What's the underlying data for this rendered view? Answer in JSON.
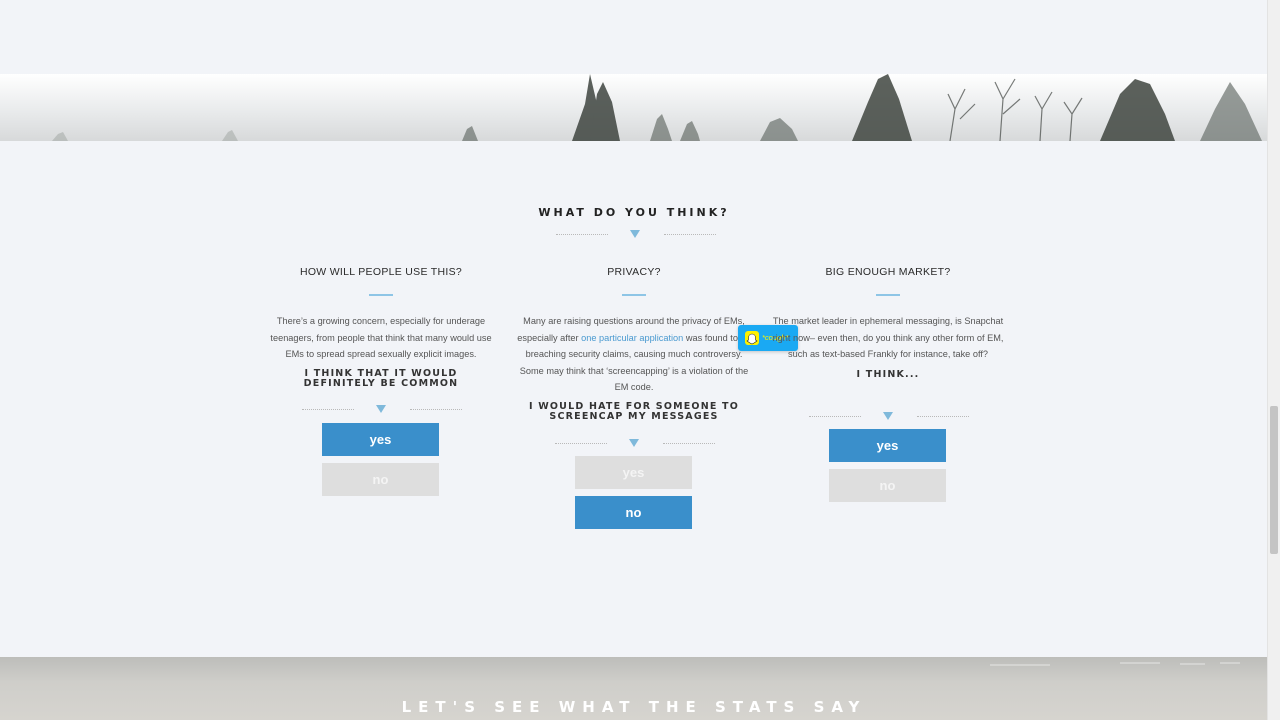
{
  "section": {
    "title": "WHAT DO YOU THINK?"
  },
  "columns": [
    {
      "heading": "HOW WILL PEOPLE USE THIS?",
      "text": "There’s a growing concern, especially for underage teenagers, from people that think that many would use EMs to spread spread sexually explicit images.",
      "opinion_line1": "I THINK THAT IT WOULD",
      "opinion_line2": "DEFINITELY BE COMMON",
      "yes_label": "yes",
      "no_label": "no",
      "selected": "yes"
    },
    {
      "heading": "PRIVACY?",
      "text_before_link": "Many are raising questions around the privacy of EMs, especially after ",
      "link_text": "one particular application",
      "text_after_link": " was found to be breaching security claims, causing much controversy. Some may think that ‘screencapping’ is a violation of the EM code.",
      "opinion_line1": "I WOULD HATE FOR SOMEONE TO",
      "opinion_line2": "SCREENCAP MY MESSAGES",
      "yes_label": "yes",
      "no_label": "no",
      "selected": "no"
    },
    {
      "heading": "BIG ENOUGH MARKET?",
      "text": "The market leader in ephemeral messaging, is Snapchat right now– even then, do you think any other form of EM, such as text-based Frankly for instance, take off?",
      "opinion_line1": "I THINK...",
      "yes_label": "yes",
      "no_label": "no",
      "selected": "yes"
    }
  ],
  "badge": {
    "icon": "snapchat-ghost-icon",
    "text": "*cough*"
  },
  "stats": {
    "title": "LET'S SEE WHAT THE STATS SAY"
  },
  "colors": {
    "accent_blue": "#3a8fcb",
    "button_gray": "#dedede",
    "snapchat_blue": "#1aa9f3",
    "snapchat_yellow": "#fff200"
  }
}
